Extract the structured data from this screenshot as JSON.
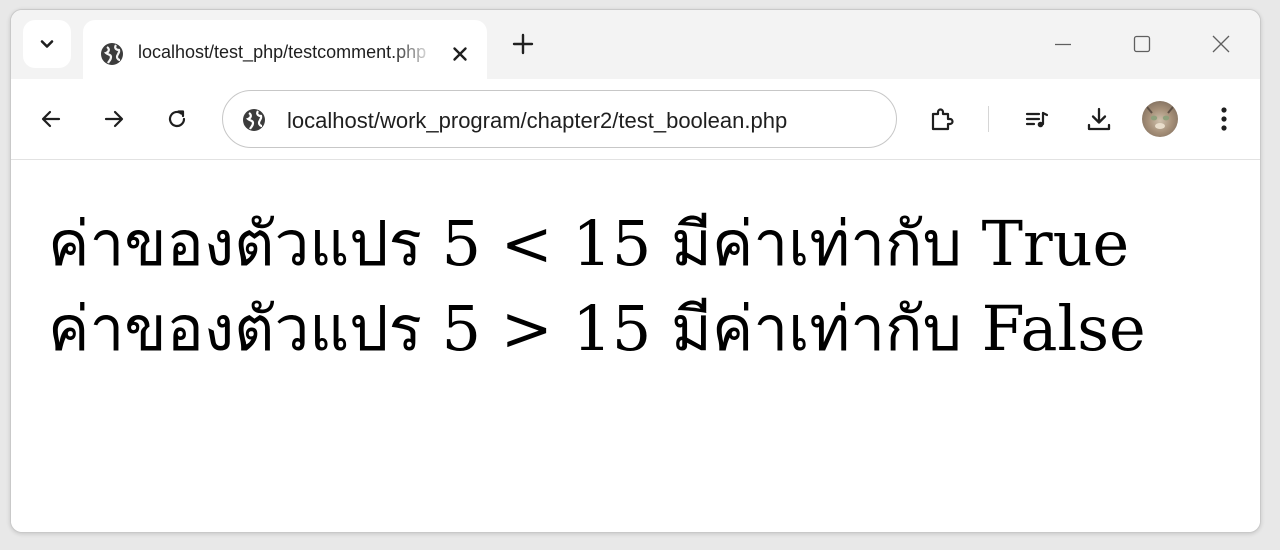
{
  "browser": {
    "tab": {
      "title": "localhost/test_php/testcomment.php",
      "favicon": "globe-icon"
    },
    "address_bar": {
      "url": "localhost/work_program/chapter2/test_boolean.php",
      "site_icon": "site-info-icon"
    },
    "toolbar_icons": [
      "back-arrow-icon",
      "forward-arrow-icon",
      "reload-icon",
      "extensions-icon",
      "media-playlist-icon",
      "download-icon",
      "avatar",
      "more-vert-icon"
    ],
    "window_controls": [
      "minimize-icon",
      "maximize-icon",
      "close-window-icon"
    ]
  },
  "page": {
    "lines": [
      "ค่าของตัวแปร 5 < 15 มีค่าเท่ากับ True",
      "ค่าของตัวแปร 5 > 15 มีค่าเท่ากับ False"
    ]
  },
  "colors": {
    "chrome_bg": "#f3f3f3",
    "page_bg": "#ffffff",
    "text": "#000000",
    "icon": "#1f1f1f"
  }
}
